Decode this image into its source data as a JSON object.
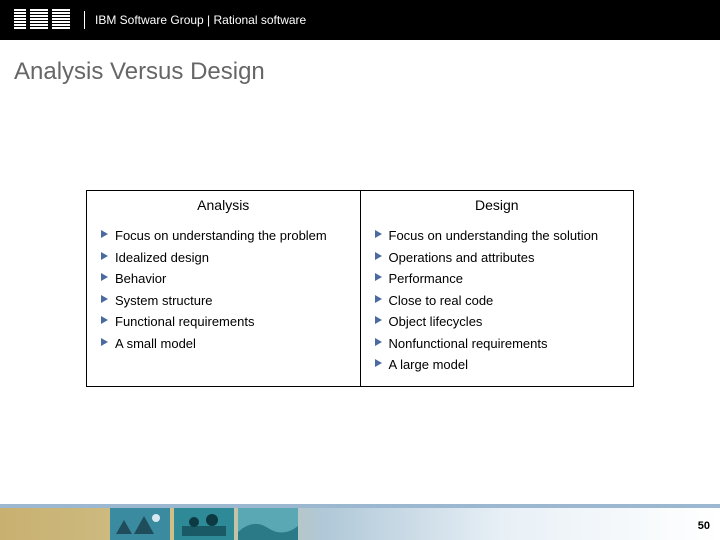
{
  "header": {
    "group_text": "IBM Software Group | Rational software"
  },
  "title": "Analysis Versus Design",
  "table": {
    "headers": {
      "left": "Analysis",
      "right": "Design"
    },
    "left_items": [
      "Focus on understanding the problem",
      "Idealized design",
      "Behavior",
      "System structure",
      "Functional requirements",
      "A small model"
    ],
    "right_items": [
      "Focus on understanding the solution",
      "Operations and attributes",
      "Performance",
      "Close to real code",
      "Object lifecycles",
      "Nonfunctional requirements",
      "A large model"
    ]
  },
  "page_number": "50"
}
